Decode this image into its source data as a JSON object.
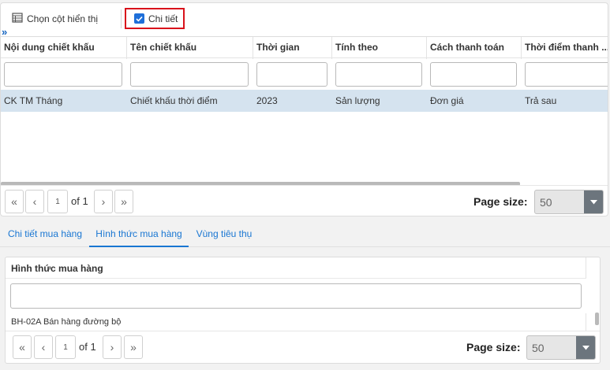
{
  "toolbar": {
    "columns_label": "Chọn cột hiển thị",
    "detail_label": "Chi tiết",
    "detail_checked": true,
    "expand_glyph": "»"
  },
  "grid": {
    "columns": [
      "Nội dung chiết khấu",
      "Tên chiết khấu",
      "Thời gian",
      "Tính theo",
      "Cách thanh toán",
      "Thời điểm thanh ..."
    ],
    "rows": [
      [
        "CK TM Tháng",
        "Chiết khấu thời điểm",
        "2023",
        "Sản lượng",
        "Đơn giá",
        "Trả sau"
      ]
    ]
  },
  "pager_top": {
    "first": "«",
    "prev": "‹",
    "page": "1",
    "of_label": "of 1",
    "next": "›",
    "last": "»",
    "page_size_label": "Page size:",
    "page_size_value": "50"
  },
  "tabs": [
    {
      "label": "Chi tiết mua hàng",
      "active": false
    },
    {
      "label": "Hình thức mua hàng",
      "active": true
    },
    {
      "label": "Vùng tiêu thụ",
      "active": false
    }
  ],
  "bottom_grid": {
    "column": "Hình thức mua hàng",
    "rows": [
      "BH-02A Bán hàng đường bộ"
    ]
  },
  "pager_bottom": {
    "first": "«",
    "prev": "‹",
    "page": "1",
    "of_label": "of 1",
    "next": "›",
    "last": "»",
    "page_size_label": "Page size:",
    "page_size_value": "50"
  },
  "colors": {
    "accent": "#1976d2",
    "selected_row": "#d5e3ef",
    "highlight_border": "#d9121b"
  }
}
